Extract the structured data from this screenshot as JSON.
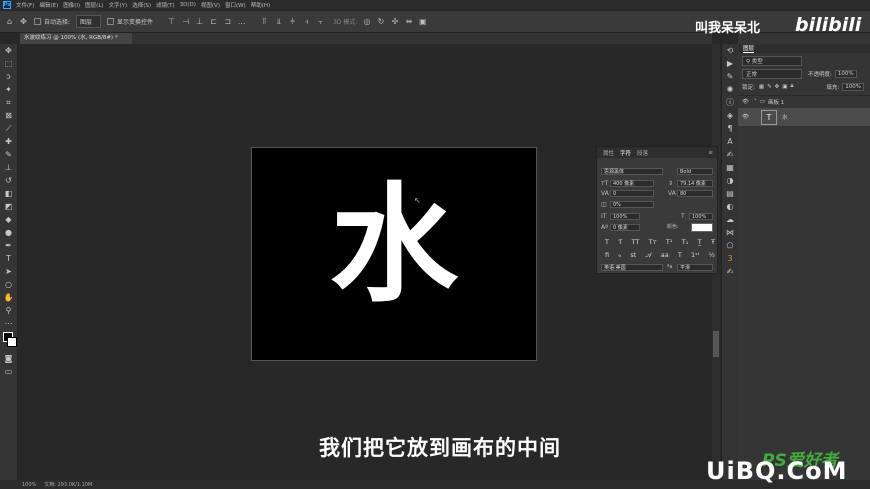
{
  "menu": {
    "logo": "Ps",
    "items": [
      "文件(F)",
      "编辑(E)",
      "图像(I)",
      "图层(L)",
      "文字(Y)",
      "选择(S)",
      "滤镜(T)",
      "3D(D)",
      "视图(V)",
      "窗口(W)",
      "帮助(H)"
    ]
  },
  "options": {
    "auto_select_label": "自动选择:",
    "auto_select_value": "图层",
    "show_transform_label": "显示变换控件",
    "mode_3d_label": "3D 模式:"
  },
  "document": {
    "tab_title": "水波纹练习 @ 100% (水, RGB/8#) *",
    "glyph": "水"
  },
  "character_panel": {
    "tabs": [
      "属性",
      "字符",
      "段落"
    ],
    "active_tab": "字符",
    "font_family": "思源黑体",
    "font_style": "Bold",
    "font_size": "400 像素",
    "leading": "79.14 像素",
    "kerning": "0",
    "tracking": "80",
    "tsume": "0%",
    "vertical_scale": "100%",
    "horizontal_scale": "100%",
    "baseline_shift": "0 像素",
    "color_label": "颜色:",
    "language": "英语:美国",
    "anti_alias": "平滑"
  },
  "layers_panel": {
    "tab": "图层",
    "filter_label": "类型",
    "blend_mode": "正常",
    "opacity_label": "不透明度:",
    "opacity": "100%",
    "lock_label": "锁定:",
    "fill_label": "填充:",
    "fill": "100%",
    "group_name": "画板 1",
    "layer_name": "水"
  },
  "status": {
    "zoom": "100%",
    "size": "文档: 293.0K/1.10M"
  },
  "overlay": {
    "subtitle": "我们把它放到画布的中间",
    "brand_cn": "叫我呆呆北",
    "brand_site": "bilibili",
    "watermark_top": "PS爱好者",
    "watermark_bottom": "UiBQ.CoM"
  },
  "colors": {
    "workspace": "#282828",
    "canvas": "#000000",
    "glyph": "#ffffff",
    "accent": "#31a8ff",
    "watermark_green": "#3fae3a"
  }
}
